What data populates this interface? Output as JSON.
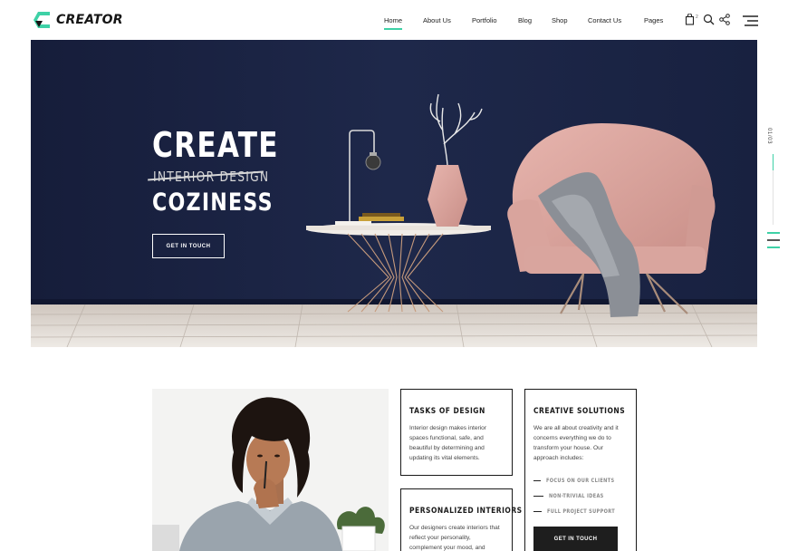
{
  "brand": {
    "name": "CREATOR"
  },
  "nav": {
    "items": [
      {
        "label": "Home",
        "active": true
      },
      {
        "label": "About Us",
        "active": false
      },
      {
        "label": "Portfolio",
        "active": false
      },
      {
        "label": "Blog",
        "active": false
      },
      {
        "label": "Shop",
        "active": false
      },
      {
        "label": "Contact Us",
        "active": false
      },
      {
        "label": "Pages",
        "active": false
      }
    ],
    "cart_count": "2",
    "icons": [
      "bag-icon",
      "search-icon",
      "share-icon",
      "menu-icon"
    ]
  },
  "hero": {
    "title_line1": "CREATE",
    "title_line2": "INTERIOR DESIGN",
    "title_line3": "COZINESS",
    "button_label": "GET IN TOUCH",
    "slide_counter": "01/03"
  },
  "cards": {
    "tasks": {
      "title": "TASKS OF DESIGN",
      "text": "Interior design makes interior spaces functional, safe, and beautiful by determining and updating its vital elements."
    },
    "personalized": {
      "title": "PERSONALIZED INTERIORS",
      "text": "Our designers create interiors that reflect your personality, complement your mood, and"
    },
    "creative": {
      "title": "CREATIVE SOLUTIONS",
      "text": "We are all about creativity and it concerns everything we do to transform your house. Our approach includes:",
      "bullets": [
        "FOCUS ON OUR CLIENTS",
        "NON-TRIVIAL IDEAS",
        "FULL PROJECT SUPPORT"
      ],
      "button_label": "GET IN TOUCH"
    }
  },
  "colors": {
    "accent": "#3ed1a6",
    "hero_wall": "#1c2545",
    "dark": "#1e1e1e"
  }
}
